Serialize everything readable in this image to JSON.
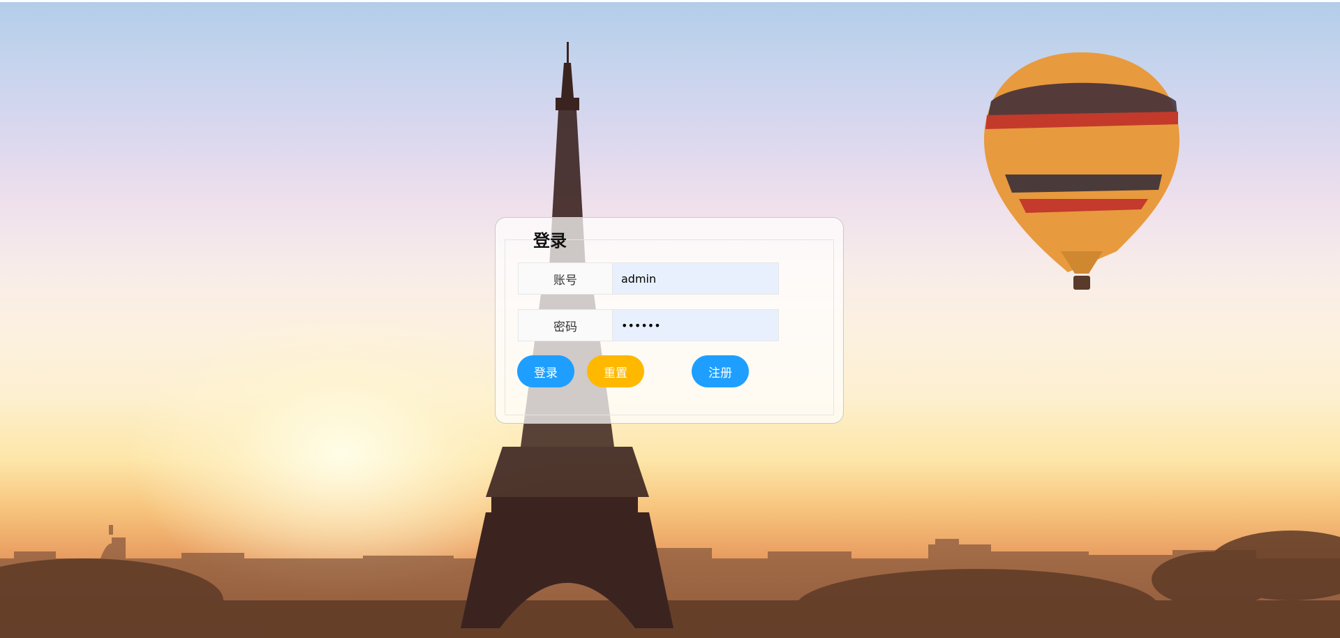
{
  "login": {
    "title": "登录",
    "username": {
      "label": "账号",
      "value": "admin"
    },
    "password": {
      "label": "密码",
      "value": "123456"
    },
    "buttons": {
      "login": "登录",
      "reset": "重置",
      "register": "注册"
    }
  },
  "colors": {
    "primary": "#1e9fff",
    "warning": "#ffb800",
    "input_fill": "#e8f0fe"
  },
  "background": {
    "icon": "eiffel-tower-sunset-with-hot-air-balloon"
  }
}
